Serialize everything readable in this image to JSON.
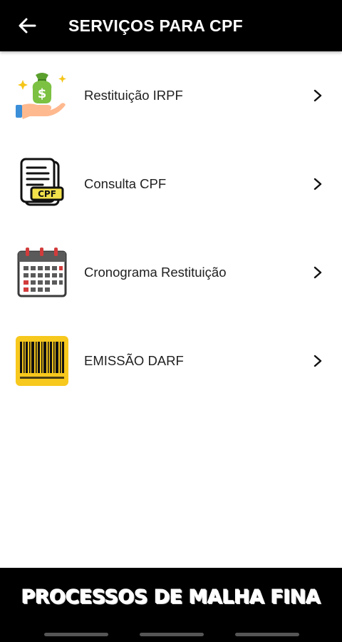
{
  "app_bar": {
    "title": "SERVIÇOS PARA CPF",
    "back_icon": "arrow-left-icon"
  },
  "items": [
    {
      "label": "Restituição IRPF",
      "icon": "money-bag-hand-icon"
    },
    {
      "label": "Consulta CPF",
      "icon": "cpf-document-icon",
      "icon_text": "CPF"
    },
    {
      "label": "Cronograma Restituição",
      "icon": "calendar-icon"
    },
    {
      "label": "EMISSÃO DARF",
      "icon": "barcode-icon"
    }
  ],
  "footer": {
    "text": "PROCESSOS DE MALHA FINA"
  },
  "colors": {
    "bar": "#000000",
    "background": "#ffffff",
    "text": "#212121",
    "barcode_bg": "#f7c81d",
    "money_green": "#7cc142"
  }
}
